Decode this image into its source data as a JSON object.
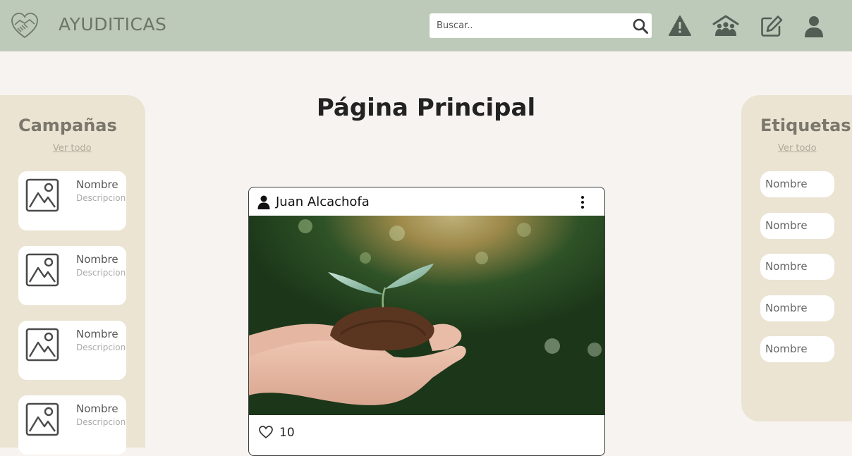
{
  "header": {
    "brand": "AYUDITICAS",
    "search_placeholder": "Buscar..",
    "icons": [
      "handshake-heart-icon",
      "search-icon",
      "alert-icon",
      "community-icon",
      "edit-icon",
      "user-icon"
    ]
  },
  "main": {
    "title": "Página Principal"
  },
  "campaigns": {
    "title": "Campañas",
    "see_all": "Ver todo",
    "items": [
      {
        "name": "Nombre",
        "description": "Descripcion"
      },
      {
        "name": "Nombre",
        "description": "Descripcion"
      },
      {
        "name": "Nombre",
        "description": "Descripcion"
      },
      {
        "name": "Nombre",
        "description": "Descripcion"
      }
    ]
  },
  "tags": {
    "title": "Etiquetas",
    "see_all": "Ver todo",
    "items": [
      "Nombre",
      "Nombre",
      "Nombre",
      "Nombre",
      "Nombre"
    ]
  },
  "post": {
    "author": "Juan Alcachofa",
    "likes": "10"
  },
  "colors": {
    "navbar": "#bdc9b9",
    "background": "#f7f3f0",
    "sidebar": "#ebe4d3",
    "icon": "#525e54"
  }
}
